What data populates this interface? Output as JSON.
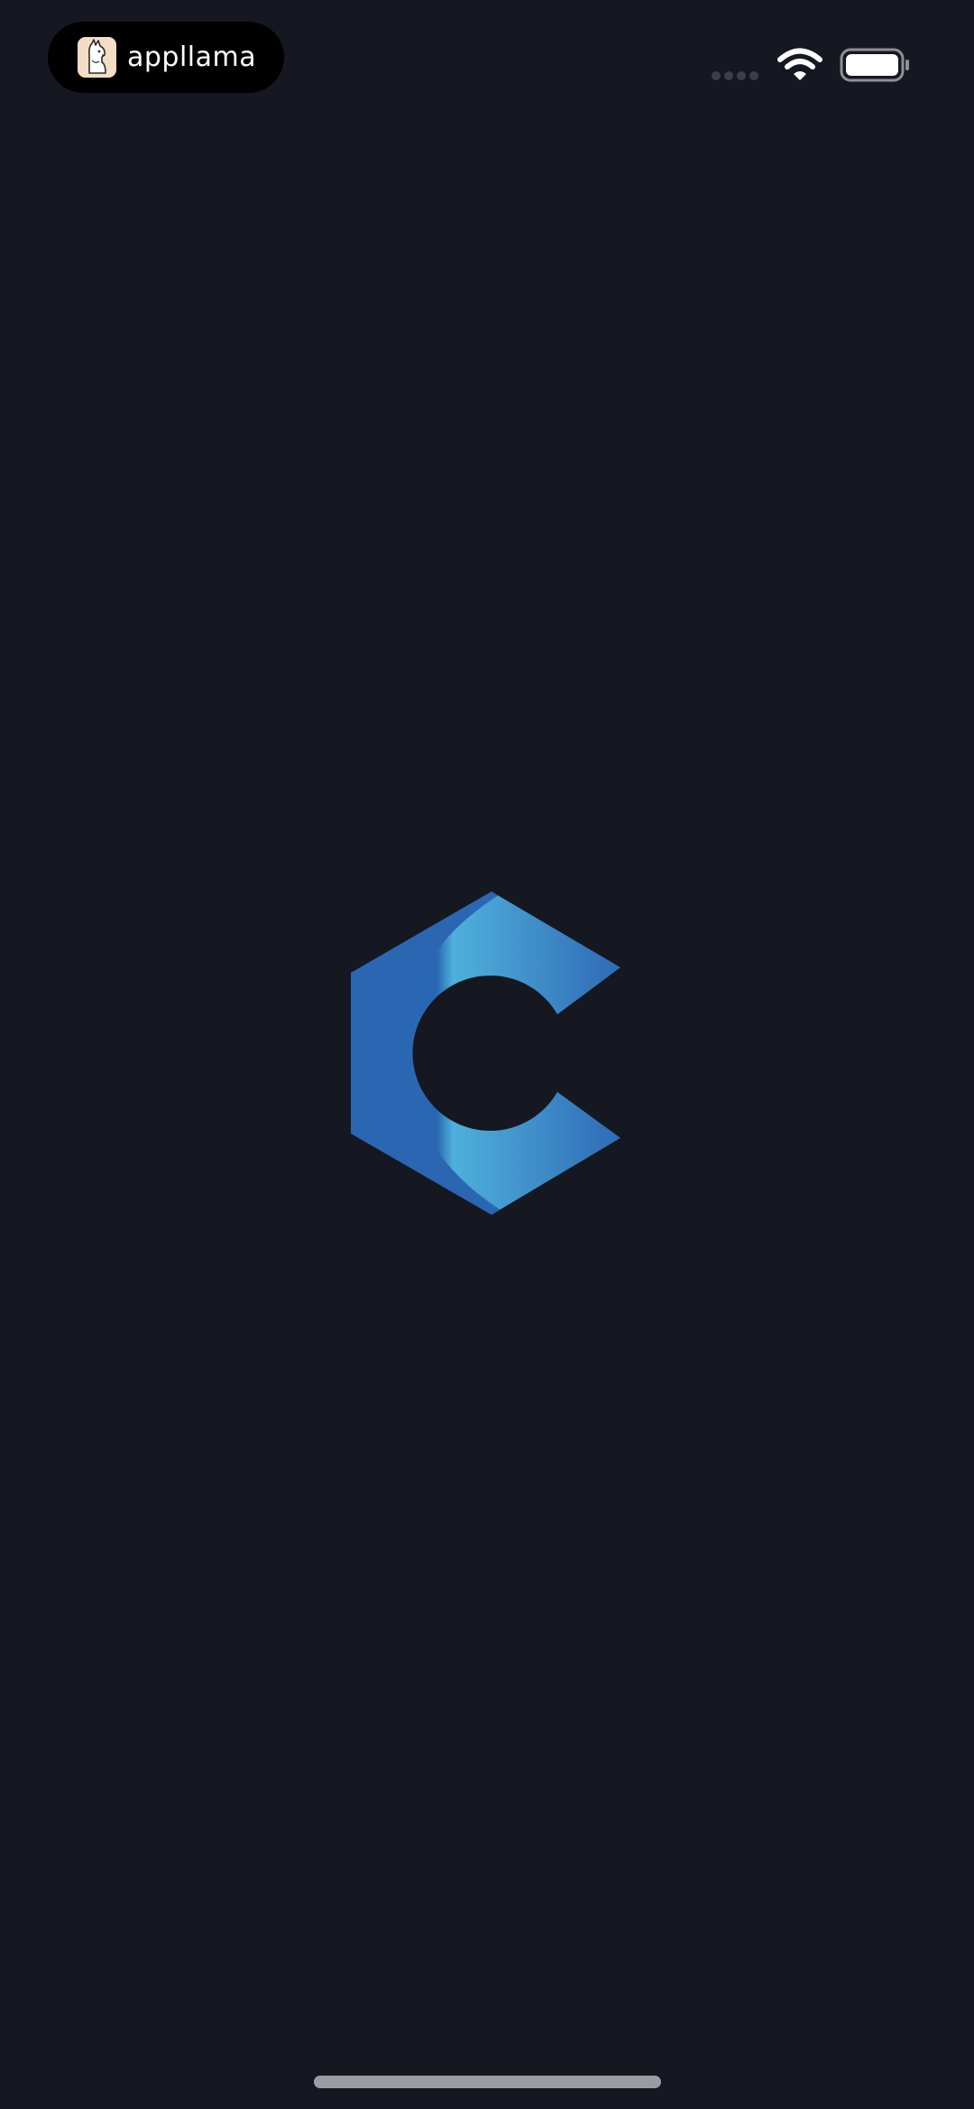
{
  "status_bar": {
    "app_indicator": {
      "name": "appllama",
      "icon": "llama-icon"
    },
    "signal_icon": "cellular-signal-icon",
    "wifi_icon": "wifi-icon",
    "battery_icon": "battery-icon"
  },
  "splash": {
    "logo_icon": "c-hexagon-logo-icon"
  },
  "colors": {
    "background": "#151821",
    "logo_dark_blue": "#2a67b3",
    "logo_light_blue": "#4fb0dc",
    "home_indicator": "#9a9ca2"
  }
}
